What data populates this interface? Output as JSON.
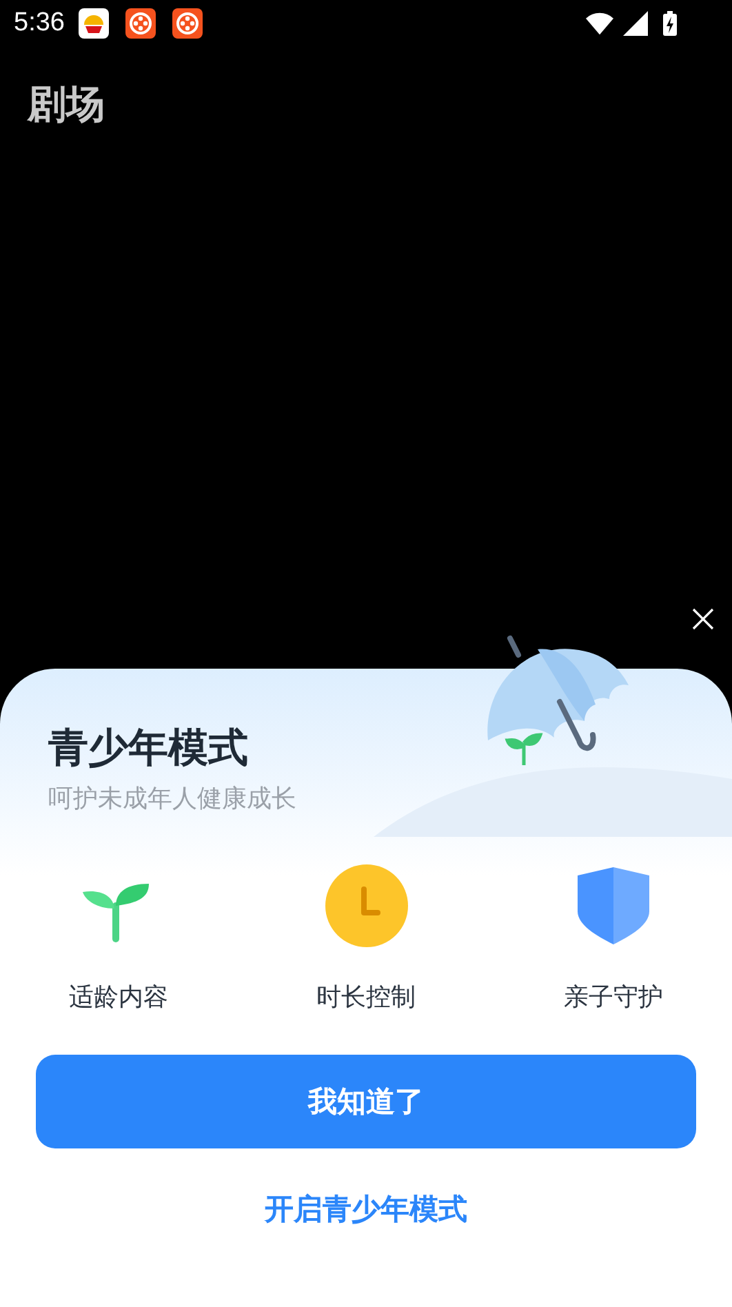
{
  "status_bar": {
    "time": "5:36",
    "notifications": [
      {
        "kind": "oil"
      },
      {
        "kind": "film"
      },
      {
        "kind": "film"
      }
    ]
  },
  "header": {
    "title": "剧场"
  },
  "sheet": {
    "title": "青少年模式",
    "subtitle": "呵护未成年人健康成长",
    "features": [
      {
        "kind": "sprout",
        "label": "适龄内容"
      },
      {
        "kind": "clock",
        "label": "时长控制"
      },
      {
        "kind": "shield",
        "label": "亲子守护"
      }
    ],
    "primary_button": "我知道了",
    "link": "开启青少年模式"
  }
}
